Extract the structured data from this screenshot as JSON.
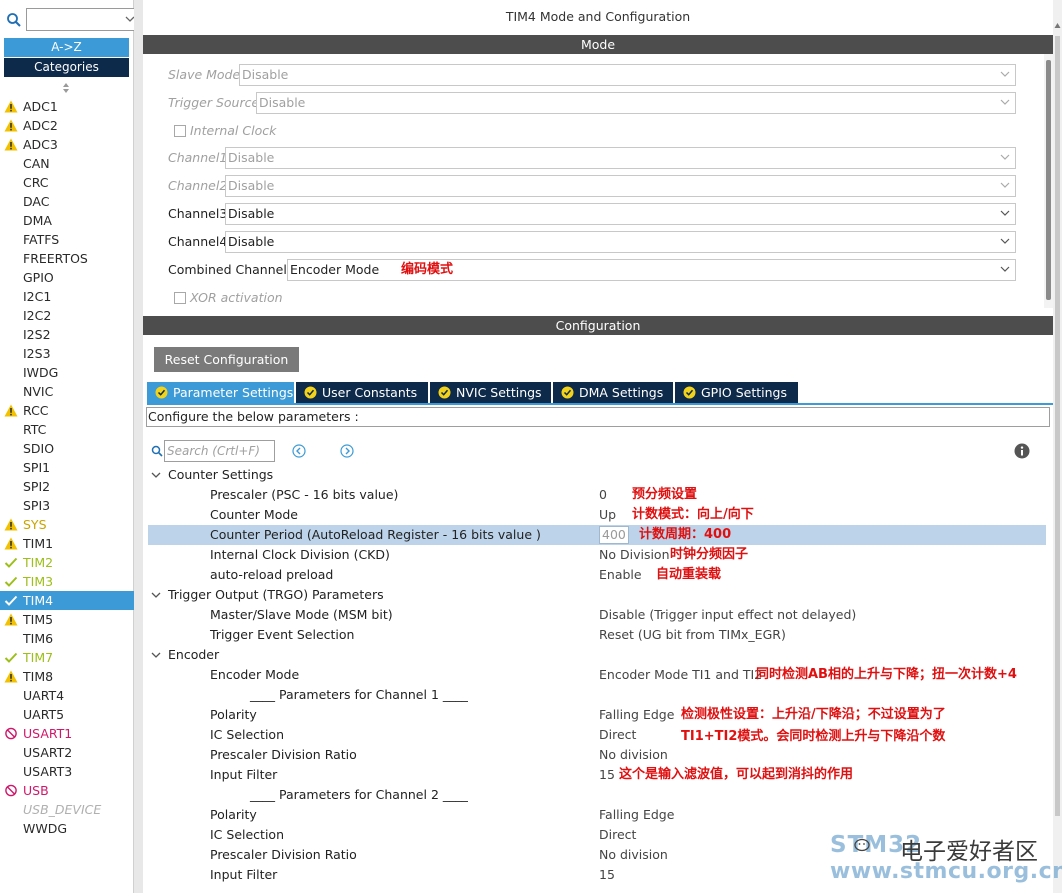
{
  "window_title": "TIM4 Mode and Configuration",
  "left_panel": {
    "search_placeholder": "",
    "btn_az": "A->Z",
    "btn_categories": "Categories",
    "items": [
      {
        "label": "ADC1",
        "state": "warning"
      },
      {
        "label": "ADC2",
        "state": "warning"
      },
      {
        "label": "ADC3",
        "state": "warning"
      },
      {
        "label": "CAN",
        "state": "normal"
      },
      {
        "label": "CRC",
        "state": "normal"
      },
      {
        "label": "DAC",
        "state": "normal"
      },
      {
        "label": "DMA",
        "state": "normal"
      },
      {
        "label": "FATFS",
        "state": "normal"
      },
      {
        "label": "FREERTOS",
        "state": "normal"
      },
      {
        "label": "GPIO",
        "state": "normal"
      },
      {
        "label": "I2C1",
        "state": "normal"
      },
      {
        "label": "I2C2",
        "state": "normal"
      },
      {
        "label": "I2S2",
        "state": "normal"
      },
      {
        "label": "I2S3",
        "state": "normal"
      },
      {
        "label": "IWDG",
        "state": "normal"
      },
      {
        "label": "NVIC",
        "state": "normal"
      },
      {
        "label": "RCC",
        "state": "warning"
      },
      {
        "label": "RTC",
        "state": "normal"
      },
      {
        "label": "SDIO",
        "state": "normal"
      },
      {
        "label": "SPI1",
        "state": "normal"
      },
      {
        "label": "SPI2",
        "state": "normal"
      },
      {
        "label": "SPI3",
        "state": "normal"
      },
      {
        "label": "SYS",
        "state": "warning-yellow"
      },
      {
        "label": "TIM1",
        "state": "warning"
      },
      {
        "label": "TIM2",
        "state": "ok"
      },
      {
        "label": "TIM3",
        "state": "ok"
      },
      {
        "label": "TIM4",
        "state": "selected"
      },
      {
        "label": "TIM5",
        "state": "warning"
      },
      {
        "label": "TIM6",
        "state": "normal"
      },
      {
        "label": "TIM7",
        "state": "ok"
      },
      {
        "label": "TIM8",
        "state": "warning"
      },
      {
        "label": "UART4",
        "state": "normal"
      },
      {
        "label": "UART5",
        "state": "normal"
      },
      {
        "label": "USART1",
        "state": "error"
      },
      {
        "label": "USART2",
        "state": "normal"
      },
      {
        "label": "USART3",
        "state": "normal"
      },
      {
        "label": "USB",
        "state": "error"
      },
      {
        "label": "USB_DEVICE",
        "state": "disabled"
      },
      {
        "label": "WWDG",
        "state": "normal"
      }
    ]
  },
  "mode": {
    "band": "Mode",
    "slave_mode": {
      "label": "Slave Mode",
      "value": "Disable"
    },
    "trigger_source": {
      "label": "Trigger Source",
      "value": "Disable"
    },
    "internal_clock": "Internal Clock",
    "channel1": {
      "label": "Channel1",
      "value": "Disable"
    },
    "channel2": {
      "label": "Channel2",
      "value": "Disable"
    },
    "channel3": {
      "label": "Channel3",
      "value": "Disable"
    },
    "channel4": {
      "label": "Channel4",
      "value": "Disable"
    },
    "combined": {
      "label": "Combined Channels",
      "value": "Encoder Mode",
      "note": "编码模式"
    },
    "xor": "XOR activation"
  },
  "configuration": {
    "band": "Configuration",
    "reset_button": "Reset Configuration",
    "tabs": [
      "Parameter Settings",
      "User Constants",
      "NVIC Settings",
      "DMA Settings",
      "GPIO Settings"
    ],
    "description": "Configure the below parameters :",
    "search_placeholder": "Search (Crtl+F)"
  },
  "params": {
    "counter_settings": "Counter Settings",
    "prescaler": {
      "name": "Prescaler (PSC - 16 bits value)",
      "value": "0",
      "note": "预分频设置"
    },
    "counter_mode": {
      "name": "Counter Mode",
      "value": "Up",
      "note": "计数模式：向上/向下"
    },
    "counter_period": {
      "name": "Counter Period (AutoReload Register - 16 bits value )",
      "value": "400",
      "note": "计数周期：400"
    },
    "ckd": {
      "name": "Internal Clock Division (CKD)",
      "value": "No Division",
      "note": "时钟分频因子"
    },
    "arpe": {
      "name": "auto-reload preload",
      "value": "Enable",
      "note": "自动重装载"
    },
    "trgo": "Trigger Output (TRGO) Parameters",
    "msm": {
      "name": "Master/Slave Mode (MSM bit)",
      "value": "Disable (Trigger input effect not delayed)"
    },
    "trigger_event": {
      "name": "Trigger Event Selection",
      "value": "Reset (UG bit from TIMx_EGR)"
    },
    "encoder": "Encoder",
    "encoder_mode": {
      "name": "Encoder Mode",
      "value": "Encoder Mode TI1 and TI2",
      "note": "同时检测AB相的上升与下降；扭一次计数+4"
    },
    "ch1_header": "____ Parameters for Channel 1 ____",
    "ch1_polarity": {
      "name": "Polarity",
      "value": "Falling Edge",
      "note": "检测极性设置：上升沿/下降沿；不过设置为了"
    },
    "ch1_ic": {
      "name": "IC Selection",
      "value": "Direct",
      "note": "TI1+TI2模式。会同时检测上升与下降沿个数"
    },
    "ch1_psc": {
      "name": "Prescaler Division Ratio",
      "value": "No division"
    },
    "ch1_filter": {
      "name": "Input Filter",
      "value": "15",
      "note": "这个是输入滤波值，可以起到消抖的作用"
    },
    "ch2_header": "____ Parameters for Channel 2 ____",
    "ch2_polarity": {
      "name": "Polarity",
      "value": "Falling Edge"
    },
    "ch2_ic": {
      "name": "IC Selection",
      "value": "Direct"
    },
    "ch2_psc": {
      "name": "Prescaler Division Ratio",
      "value": "No division"
    },
    "ch2_filter": {
      "name": "Input Filter",
      "value": "15"
    }
  },
  "watermark": {
    "line1_en": "STM32",
    "line1_cn": "电子爱好者区",
    "line2": "www.stmcu.org.cn"
  },
  "colors": {
    "accent": "#3c9bd6",
    "dark_nav": "#0e2a4a",
    "band": "#4d4d4d",
    "annotation": "#e01010",
    "ok": "#9cbf1a",
    "error": "#d0186a",
    "warning": "#f2c200"
  }
}
